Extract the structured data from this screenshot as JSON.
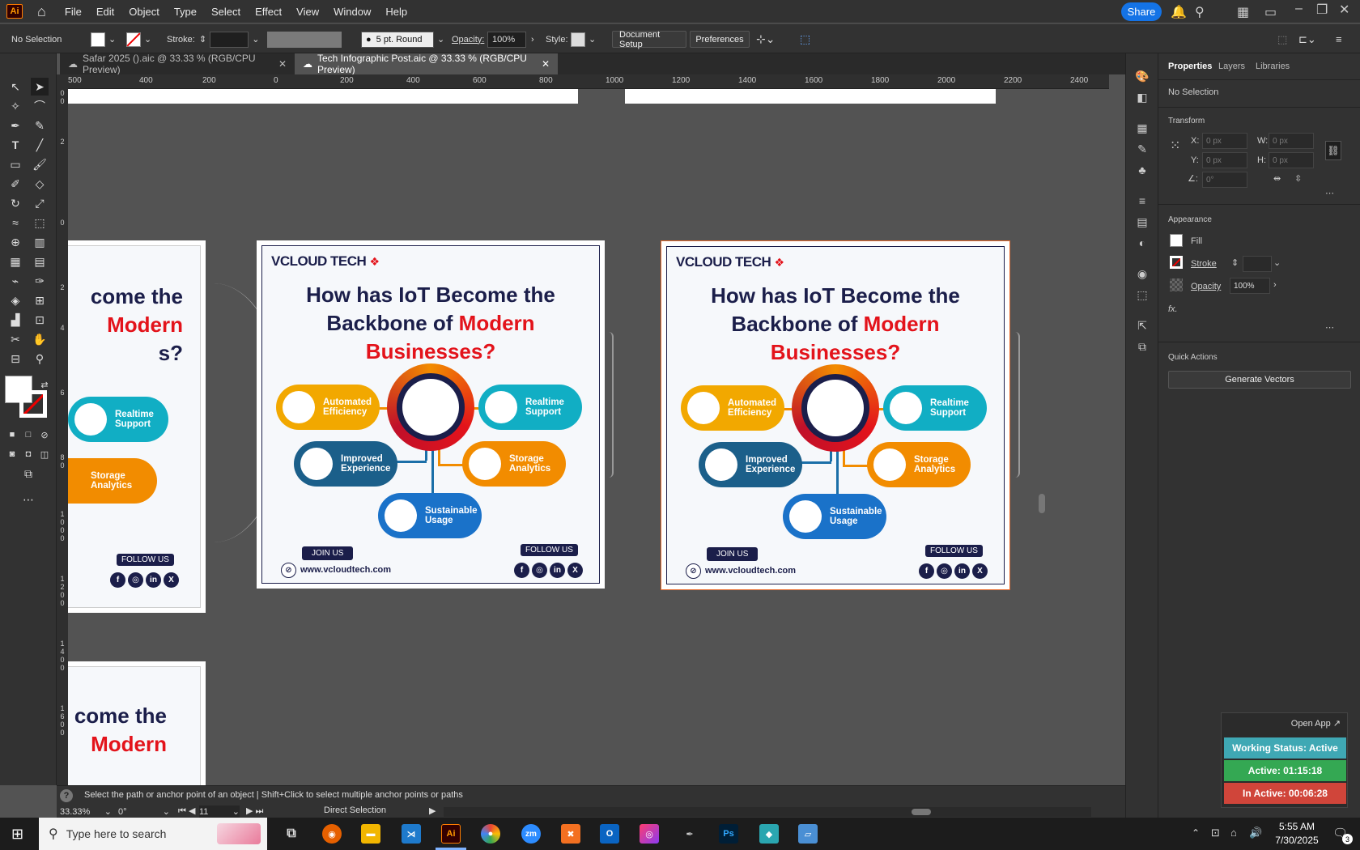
{
  "menubar": {
    "app_badge": "Ai",
    "items": [
      "File",
      "Edit",
      "Object",
      "Type",
      "Select",
      "Effect",
      "View",
      "Window",
      "Help"
    ],
    "share_label": "Share"
  },
  "control": {
    "selection": "No Selection",
    "stroke_label": "Stroke:",
    "brush": "5 pt. Round",
    "opacity_label": "Opacity:",
    "opacity_value": "100%",
    "style_label": "Style:",
    "document_setup": "Document Setup",
    "preferences": "Preferences"
  },
  "tabs": [
    {
      "label": "Safar 2025 ().aic @ 33.33 % (RGB/CPU Preview)",
      "active": false
    },
    {
      "label": "Tech Infographic Post.aic @ 33.33 % (RGB/CPU Preview)",
      "active": true
    }
  ],
  "ruler": {
    "h_ticks": [
      "500",
      "400",
      "200",
      "0",
      "200",
      "400",
      "600",
      "800",
      "1000",
      "1200",
      "1400",
      "1600",
      "1800",
      "2000",
      "2200",
      "2400"
    ]
  },
  "artwork": {
    "brand": "VCLOUD TECH",
    "headline_1": "How has IoT Become the",
    "headline_2a": "Backbone of ",
    "headline_2b": "Modern",
    "headline_3": "Businesses?",
    "pills": {
      "automated": "Automated Efficiency",
      "realtime": "Realtime Support",
      "improved": "Improved Experience",
      "storage": "Storage Analytics",
      "sustainable": "Sustainable Usage"
    },
    "follow": "FOLLOW US",
    "join": "JOIN US",
    "url": "www.vcloudtech.com",
    "partial_1": "come the",
    "partial_2": "Modern",
    "partial_3": "s?",
    "social": [
      "f",
      "◎",
      "in",
      "X"
    ],
    "colors": {
      "navy": "#1b1e4a",
      "red": "#e3131b",
      "orange": "#f28c00",
      "teal": "#11aec4",
      "blue": "#1b6fa8"
    }
  },
  "panel": {
    "tabs": [
      "Properties",
      "Layers",
      "Libraries"
    ],
    "selection": "No Selection",
    "transform": "Transform",
    "x_label": "X:",
    "y_label": "Y:",
    "w_label": "W:",
    "h_label": "H:",
    "x_value": "0 px",
    "y_value": "0 px",
    "w_value": "0 px",
    "h_value": "0 px",
    "angle_value": "0°",
    "appearance": "Appearance",
    "fill": "Fill",
    "stroke": "Stroke",
    "opacity": "Opacity",
    "opacity_value": "100%",
    "fx": "fx.",
    "quick_actions": "Quick Actions",
    "generate_vectors": "Generate Vectors"
  },
  "status": {
    "hint": "Select the path or anchor point of an object  |  Shift+Click to select multiple anchor points or paths",
    "zoom": "33.33%",
    "rotation": "0°",
    "artboard_num": "11",
    "tool": "Direct Selection"
  },
  "widget": {
    "open_app": "Open App ↗",
    "working": "Working Status: Active",
    "active": "Active: 01:15:18",
    "inactive": "In Active: 00:06:28"
  },
  "taskbar": {
    "search_placeholder": "Type here to search",
    "time": "5:55 AM",
    "date": "7/30/2025",
    "notifications": "3"
  }
}
